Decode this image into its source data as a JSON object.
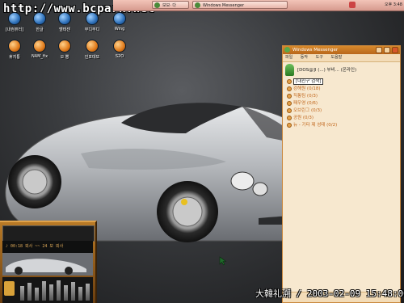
{
  "watermark": "http://www.bcpark.net",
  "taskbar": {
    "buttons": [
      {
        "label": "보보· 다"
      },
      {
        "label": "Windows Messenger"
      }
    ],
    "clock": "오후 3:48"
  },
  "desktop_icons": [
    {
      "label": "[내컴퓨터]",
      "icon": "computer-icon"
    },
    {
      "label": "한글",
      "icon": "hangul-icon"
    },
    {
      "label": "벨테센",
      "icon": "app-icon"
    },
    {
      "label": "부디부디",
      "icon": "buddy-icon"
    },
    {
      "label": "Wing",
      "icon": "wing-icon"
    },
    {
      "label": "휴지통",
      "icon": "recycle-bin-icon"
    },
    {
      "label": "NAM_fix",
      "icon": "app-icon"
    },
    {
      "label": "오 뽕",
      "icon": "app-icon"
    },
    {
      "label": "인포데또",
      "icon": "app-icon"
    },
    {
      "label": "S2O",
      "icon": "app-icon"
    }
  ],
  "messenger": {
    "title": "Windows Messenger",
    "menu": [
      "파일",
      "동작",
      "도구",
      "도움말"
    ],
    "status_name": "[DOS@]I (...) 부비...",
    "status_tag": "(온라인)",
    "groups": [
      {
        "label": "[내친구 검색]",
        "selected": true
      },
      {
        "label": "강해원 (0/18)"
      },
      {
        "label": "직통팀 (0/3)"
      },
      {
        "label": "패우영 (0/6)"
      },
      {
        "label": "오브린그 (0/3)"
      },
      {
        "label": "공원 (0/3)"
      },
      {
        "label": "뉴 - 기타 제 성태 (0/2)"
      }
    ]
  },
  "player": {
    "display": "♪ 00:18  뵈사 ~~ 24 보 뵈사"
  },
  "datetime": "大韓礼溯 / 2003-02-09 15:48:00",
  "colors": {
    "messenger_accent": "#c9883e",
    "watermark": "#ffffff"
  }
}
